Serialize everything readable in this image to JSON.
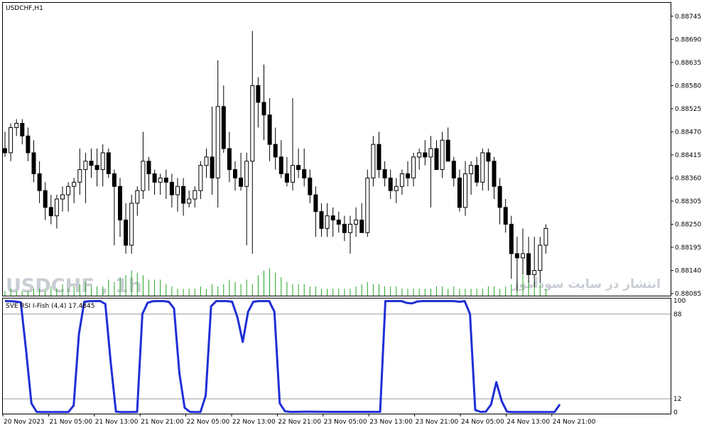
{
  "main_chart": {
    "symbol_title": "USDCHF,H1",
    "price_ticks": [
      "0.88745",
      "0.88690",
      "0.88635",
      "0.88580",
      "0.88525",
      "0.88470",
      "0.88415",
      "0.88360",
      "0.88305",
      "0.88250",
      "0.88195",
      "0.88140",
      "0.88085"
    ],
    "watermark_symbol": "USDCHF , 1h",
    "watermark_site": "انتشار در سایت سودآموز"
  },
  "indicator": {
    "title": "SVE RSI I-Fish (4,4) 17.4845",
    "level_ticks": [
      "100",
      "88",
      "12",
      "0"
    ]
  },
  "time_axis": {
    "labels": [
      "20 Nov 2023",
      "21 Nov 05:00",
      "21 Nov 13:00",
      "21 Nov 21:00",
      "22 Nov 05:00",
      "22 Nov 13:00",
      "22 Nov 21:00",
      "23 Nov 05:00",
      "23 Nov 13:00",
      "23 Nov 21:00",
      "24 Nov 05:00",
      "24 Nov 13:00",
      "24 Nov 21:00"
    ]
  },
  "colors": {
    "bull_candle": "#ffffff",
    "bear_candle": "#000000",
    "volume_bar": "#22a522",
    "indicator_line": "#1f2fd6",
    "level_line": "#9a9a9a"
  },
  "chart_data": [
    {
      "type": "candlestick",
      "title": "USDCHF,H1",
      "ylim": [
        0.8808,
        0.8877
      ],
      "x": [
        "20 Nov 2023",
        "21 Nov 05:00",
        "21 Nov 13:00",
        "21 Nov 21:00",
        "22 Nov 05:00",
        "22 Nov 13:00",
        "22 Nov 21:00",
        "23 Nov 05:00",
        "23 Nov 13:00",
        "23 Nov 21:00",
        "24 Nov 05:00",
        "24 Nov 13:00",
        "24 Nov 21:00"
      ],
      "ohlc": [
        [
          0.8843,
          0.8847,
          0.8841,
          0.8842
        ],
        [
          0.8842,
          0.8849,
          0.884,
          0.8848
        ],
        [
          0.8848,
          0.885,
          0.8846,
          0.8849
        ],
        [
          0.8849,
          0.885,
          0.8844,
          0.8846
        ],
        [
          0.8846,
          0.8848,
          0.884,
          0.8842
        ],
        [
          0.8842,
          0.8845,
          0.8835,
          0.8837
        ],
        [
          0.8837,
          0.884,
          0.883,
          0.8833
        ],
        [
          0.8833,
          0.8835,
          0.8826,
          0.8829
        ],
        [
          0.8829,
          0.8832,
          0.8825,
          0.8827
        ],
        [
          0.8827,
          0.8832,
          0.8824,
          0.8831
        ],
        [
          0.8831,
          0.8834,
          0.8828,
          0.8832
        ],
        [
          0.8832,
          0.8835,
          0.8828,
          0.8834
        ],
        [
          0.8834,
          0.8836,
          0.883,
          0.8835
        ],
        [
          0.8835,
          0.8843,
          0.8832,
          0.8838
        ],
        [
          0.8838,
          0.8842,
          0.883,
          0.884
        ],
        [
          0.884,
          0.8843,
          0.8836,
          0.8839
        ],
        [
          0.8839,
          0.8843,
          0.8834,
          0.8838
        ],
        [
          0.8838,
          0.8844,
          0.8834,
          0.8842
        ],
        [
          0.8842,
          0.8843,
          0.8836,
          0.8837
        ],
        [
          0.8837,
          0.8838,
          0.882,
          0.8834
        ],
        [
          0.8834,
          0.8836,
          0.8822,
          0.8826
        ],
        [
          0.8826,
          0.883,
          0.8818,
          0.882
        ],
        [
          0.882,
          0.8832,
          0.8818,
          0.883
        ],
        [
          0.883,
          0.8834,
          0.8827,
          0.8833
        ],
        [
          0.8833,
          0.8847,
          0.8831,
          0.884
        ],
        [
          0.884,
          0.8841,
          0.8833,
          0.8837
        ],
        [
          0.8837,
          0.8838,
          0.8832,
          0.8835
        ],
        [
          0.8835,
          0.8837,
          0.8832,
          0.8836
        ],
        [
          0.8836,
          0.8838,
          0.8831,
          0.8835
        ],
        [
          0.8835,
          0.8837,
          0.8829,
          0.8832
        ],
        [
          0.8832,
          0.8836,
          0.8828,
          0.8834
        ],
        [
          0.8834,
          0.8836,
          0.8827,
          0.883
        ],
        [
          0.883,
          0.8833,
          0.8829,
          0.8831
        ],
        [
          0.8831,
          0.8834,
          0.8829,
          0.8833
        ],
        [
          0.8833,
          0.884,
          0.8831,
          0.8839
        ],
        [
          0.8839,
          0.8843,
          0.8836,
          0.8841
        ],
        [
          0.8841,
          0.8853,
          0.8832,
          0.8836
        ],
        [
          0.8836,
          0.8864,
          0.8829,
          0.8853
        ],
        [
          0.8853,
          0.8858,
          0.8842,
          0.8843
        ],
        [
          0.8843,
          0.8847,
          0.8835,
          0.8838
        ],
        [
          0.8838,
          0.884,
          0.8833,
          0.8836
        ],
        [
          0.8836,
          0.8842,
          0.8833,
          0.8834
        ],
        [
          0.8834,
          0.8842,
          0.882,
          0.884
        ],
        [
          0.884,
          0.8871,
          0.8818,
          0.8858
        ],
        [
          0.8858,
          0.886,
          0.8848,
          0.8854
        ],
        [
          0.8854,
          0.8863,
          0.8845,
          0.8851
        ],
        [
          0.8851,
          0.8855,
          0.884,
          0.8844
        ],
        [
          0.8844,
          0.8848,
          0.8838,
          0.8841
        ],
        [
          0.8841,
          0.8845,
          0.8836,
          0.8837
        ],
        [
          0.8837,
          0.8841,
          0.8834,
          0.8835
        ],
        [
          0.8835,
          0.8855,
          0.8833,
          0.8839
        ],
        [
          0.8839,
          0.8843,
          0.8836,
          0.8838
        ],
        [
          0.8838,
          0.8843,
          0.8834,
          0.8836
        ],
        [
          0.8836,
          0.8838,
          0.883,
          0.8832
        ],
        [
          0.8832,
          0.8834,
          0.8822,
          0.8828
        ],
        [
          0.8828,
          0.883,
          0.8822,
          0.8824
        ],
        [
          0.8824,
          0.883,
          0.8822,
          0.8827
        ],
        [
          0.8827,
          0.8829,
          0.8822,
          0.8826
        ],
        [
          0.8826,
          0.8828,
          0.8823,
          0.8825
        ],
        [
          0.8825,
          0.8827,
          0.8821,
          0.8823
        ],
        [
          0.8823,
          0.8827,
          0.8818,
          0.8825
        ],
        [
          0.8825,
          0.8829,
          0.8822,
          0.8826
        ],
        [
          0.8826,
          0.883,
          0.8824,
          0.8823
        ],
        [
          0.8823,
          0.8838,
          0.8822,
          0.8836
        ],
        [
          0.8836,
          0.8846,
          0.8834,
          0.8844
        ],
        [
          0.8844,
          0.8847,
          0.8836,
          0.8838
        ],
        [
          0.8838,
          0.884,
          0.8834,
          0.8836
        ],
        [
          0.8836,
          0.8838,
          0.8831,
          0.8833
        ],
        [
          0.8833,
          0.8836,
          0.883,
          0.8834
        ],
        [
          0.8834,
          0.8838,
          0.8832,
          0.8837
        ],
        [
          0.8837,
          0.884,
          0.8834,
          0.8836
        ],
        [
          0.8836,
          0.8842,
          0.8834,
          0.8841
        ],
        [
          0.8841,
          0.8843,
          0.8838,
          0.8842
        ],
        [
          0.8842,
          0.8845,
          0.8839,
          0.8841
        ],
        [
          0.8841,
          0.8846,
          0.8829,
          0.8843
        ],
        [
          0.8843,
          0.8845,
          0.8838,
          0.8838
        ],
        [
          0.8838,
          0.8847,
          0.8836,
          0.8845
        ],
        [
          0.8845,
          0.8848,
          0.884,
          0.884
        ],
        [
          0.884,
          0.8841,
          0.8834,
          0.8836
        ],
        [
          0.8836,
          0.8838,
          0.8828,
          0.8829
        ],
        [
          0.8829,
          0.884,
          0.8827,
          0.8837
        ],
        [
          0.8837,
          0.884,
          0.8832,
          0.8839
        ],
        [
          0.8839,
          0.8841,
          0.8834,
          0.8835
        ],
        [
          0.8835,
          0.8843,
          0.8833,
          0.8842
        ],
        [
          0.8842,
          0.8843,
          0.8833,
          0.884
        ],
        [
          0.884,
          0.8841,
          0.8831,
          0.8834
        ],
        [
          0.8834,
          0.8836,
          0.8825,
          0.8829
        ],
        [
          0.8829,
          0.8831,
          0.8823,
          0.8825
        ],
        [
          0.8825,
          0.8827,
          0.8812,
          0.8818
        ],
        [
          0.8818,
          0.8822,
          0.8809,
          0.8817
        ],
        [
          0.8817,
          0.8824,
          0.8813,
          0.8818
        ],
        [
          0.8818,
          0.8822,
          0.8811,
          0.8813
        ],
        [
          0.8813,
          0.8822,
          0.881,
          0.8814
        ],
        [
          0.8814,
          0.8822,
          0.8811,
          0.882
        ],
        [
          0.882,
          0.8825,
          0.8818,
          0.8824
        ]
      ]
    },
    {
      "type": "bar",
      "title": "",
      "values": [
        2,
        3,
        2,
        2,
        2,
        3,
        3,
        2,
        4,
        3,
        5,
        3,
        4,
        5,
        6,
        4,
        4,
        4,
        7,
        6,
        8,
        9,
        11,
        10,
        9,
        7,
        7,
        7,
        5,
        4,
        3,
        3,
        3,
        3,
        4,
        3,
        5,
        4,
        5,
        7,
        6,
        5,
        7,
        5,
        9,
        11,
        12,
        10,
        8,
        6,
        5,
        5,
        5,
        4,
        4,
        3,
        3,
        3,
        3,
        3,
        3,
        4,
        5,
        6,
        5,
        5,
        4,
        4,
        4,
        3,
        3,
        3,
        3,
        3,
        3,
        4,
        4,
        3,
        4,
        3,
        3,
        3,
        3,
        3,
        4,
        4,
        3,
        4,
        5,
        8,
        9,
        7,
        6,
        5,
        3
      ]
    },
    {
      "type": "line",
      "title": "SVE RSI I-Fish (4,4) 17.4845",
      "ylim": [
        0,
        100
      ],
      "series": [
        {
          "values": [
            99.6,
            99.5,
            99.2,
            98.5,
            55,
            8,
            0.3,
            0.2,
            0.1,
            0.1,
            0.1,
            0.1,
            0.2,
            6,
            70,
            99,
            99.5,
            99.6,
            99.7,
            97,
            45,
            0.5,
            0.2,
            0.2,
            0.2,
            0.3,
            88,
            98,
            99.5,
            99.6,
            99.6,
            99,
            93,
            35,
            4,
            0.3,
            0.2,
            0.2,
            15,
            95,
            99.6,
            99.6,
            99.6,
            99,
            85,
            63,
            90,
            99,
            99.6,
            99.6,
            99.6,
            90,
            8,
            0.8,
            0.3,
            0.3,
            0.4,
            0.5,
            0.5,
            0.4,
            0.4,
            0.3,
            0.3,
            0.3,
            0.3,
            0.3,
            0.3,
            0.3,
            0.3,
            0.3,
            0.3,
            0.3,
            99.6,
            99.6,
            99.6,
            99.6,
            98,
            97.5,
            99.2,
            99.6,
            99.6,
            99.6,
            99.6,
            99.6,
            99.6,
            99.6,
            99,
            99.6,
            88,
            2,
            0.3,
            0.5,
            7,
            27,
            10,
            0.5,
            0.2,
            0.2,
            0.2,
            0.2,
            0.2,
            0.2,
            0.2,
            0.2,
            0.2,
            7
          ]
        }
      ]
    }
  ]
}
